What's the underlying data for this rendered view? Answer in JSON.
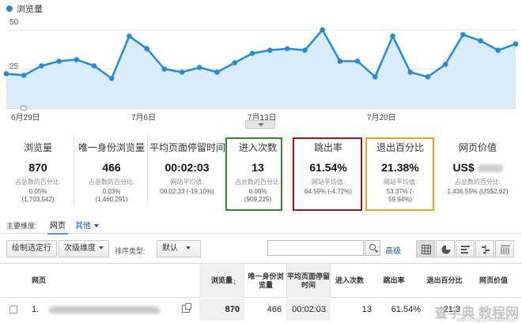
{
  "chart": {
    "legend_label": "浏览量",
    "y_ticks": [
      "50",
      "25"
    ],
    "x_ticks": [
      "6月29日",
      "7月6日",
      "7月13日",
      "7月20日"
    ],
    "colors": {
      "line": "#1f8ddb",
      "fill": "#d8edf9"
    }
  },
  "chart_data": {
    "type": "area",
    "title": "",
    "legend": "浏览量",
    "ylim": [
      0,
      60
    ],
    "x": [
      "6月29日",
      "6月30日",
      "7月1日",
      "7月2日",
      "7月3日",
      "7月4日",
      "7月5日",
      "7月6日",
      "7月7日",
      "7月8日",
      "7月9日",
      "7月10日",
      "7月11日",
      "7月12日",
      "7月13日",
      "7月14日",
      "7月15日",
      "7月16日",
      "7月17日",
      "7月18日",
      "7月19日",
      "7月20日",
      "7月21日",
      "7月22日",
      "7月23日",
      "7月24日",
      "7月25日",
      "7月26日",
      "7月27日",
      "7月28日"
    ],
    "values": [
      22,
      21,
      27,
      30,
      31,
      27,
      19,
      46,
      38,
      25,
      23,
      26,
      23,
      29,
      35,
      37,
      38,
      37,
      50,
      30,
      30,
      20,
      46,
      23,
      20,
      28,
      47,
      43,
      37,
      41
    ],
    "grid": true
  },
  "metrics": [
    {
      "title": "浏览量",
      "value": "870",
      "sub1": "占总数的百分比:",
      "sub2": "0.05%",
      "sub3": "(1,703,542)"
    },
    {
      "title": "唯一身份浏览量",
      "value": "466",
      "sub1": "占总数的百分比:",
      "sub2": "0.03%",
      "sub3": "(1,460,291)"
    },
    {
      "title": "平均页面停留时间",
      "value": "00:02:03",
      "sub1": "网站平均值:",
      "sub2": "00:02:33 (-19.10%)",
      "sub3": ""
    },
    {
      "title": "进入次数",
      "value": "13",
      "sub1": "占总数的百分比:",
      "sub2": "0.00%",
      "sub3": "(909,225)"
    },
    {
      "title": "跳出率",
      "value": "61.54%",
      "sub1": "网站平均值:",
      "sub2": "64.59% (-4.72%)",
      "sub3": ""
    },
    {
      "title": "退出百分比",
      "value": "21.38%",
      "sub1": "网站平均值:",
      "sub2": "53.37% (-",
      "sub3": "59.94%)"
    },
    {
      "title": "网页价值",
      "value": "US$",
      "sub1": "占总数的百分比:",
      "sub2": "1,436.55% (US$2.62)",
      "sub3": ""
    }
  ],
  "highlight_colors": {
    "entries": "#2e8b2e",
    "bounce": "#a31515",
    "exit": "#f0a020"
  },
  "dimension": {
    "label": "主要维度:",
    "selected": "网页",
    "other": "其他"
  },
  "toolbar": {
    "plot_rows": "绘制选定行",
    "secondary_dim": "次级维度",
    "sort_label": "排序类型:",
    "sort_value": "默认",
    "advanced": "高级"
  },
  "table": {
    "headers": [
      "网页",
      "浏览量",
      "唯一身份浏览量",
      "平均页面停留时间",
      "进入次数",
      "跳出率",
      "退出百分比",
      "网页价值"
    ],
    "row": {
      "num": "1.",
      "pageviews": "870",
      "unique": "466",
      "avg_time": "00:02:03",
      "entries": "13",
      "bounce": "61.54%",
      "exit": "21.3",
      "value": ""
    }
  },
  "watermark": {
    "main": "查字典 教程网",
    "sub": "jiaocheng.chazidian.com"
  }
}
